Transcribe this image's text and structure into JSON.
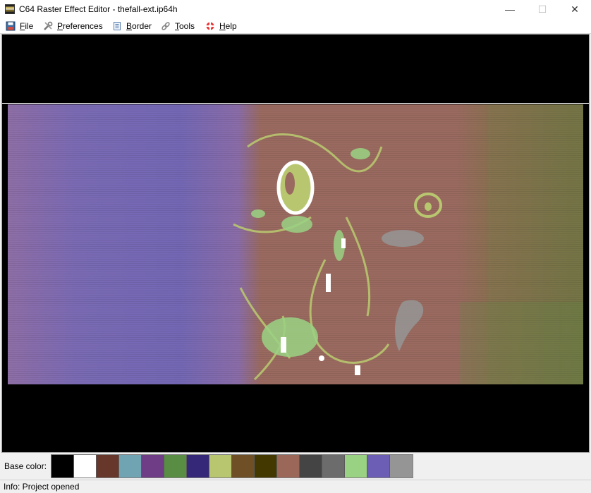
{
  "window": {
    "title": "C64 Raster Effect Editor - thefall-ext.ip64h",
    "controls": {
      "minimize": "—",
      "maximize": "☐",
      "close": "✕"
    }
  },
  "menu": [
    {
      "label": "File",
      "icon": "floppy-disk-icon"
    },
    {
      "label": "Preferences",
      "icon": "tools-icon"
    },
    {
      "label": "Border",
      "icon": "document-icon"
    },
    {
      "label": "Tools",
      "icon": "link-icon"
    },
    {
      "label": "Help",
      "icon": "lifebuoy-icon"
    }
  ],
  "palette": {
    "label": "Base color:",
    "colors": [
      "#000000",
      "#ffffff",
      "#68372b",
      "#70a4b2",
      "#6f3d86",
      "#588d43",
      "#352879",
      "#b8c76f",
      "#6f4f25",
      "#433900",
      "#9a6759",
      "#444444",
      "#6c6c6c",
      "#9ad284",
      "#6c5eb5",
      "#959595"
    ]
  },
  "status": {
    "text": "Info: Project opened"
  },
  "colors": {
    "border": "#000000",
    "raster_line": "#ffffff"
  }
}
